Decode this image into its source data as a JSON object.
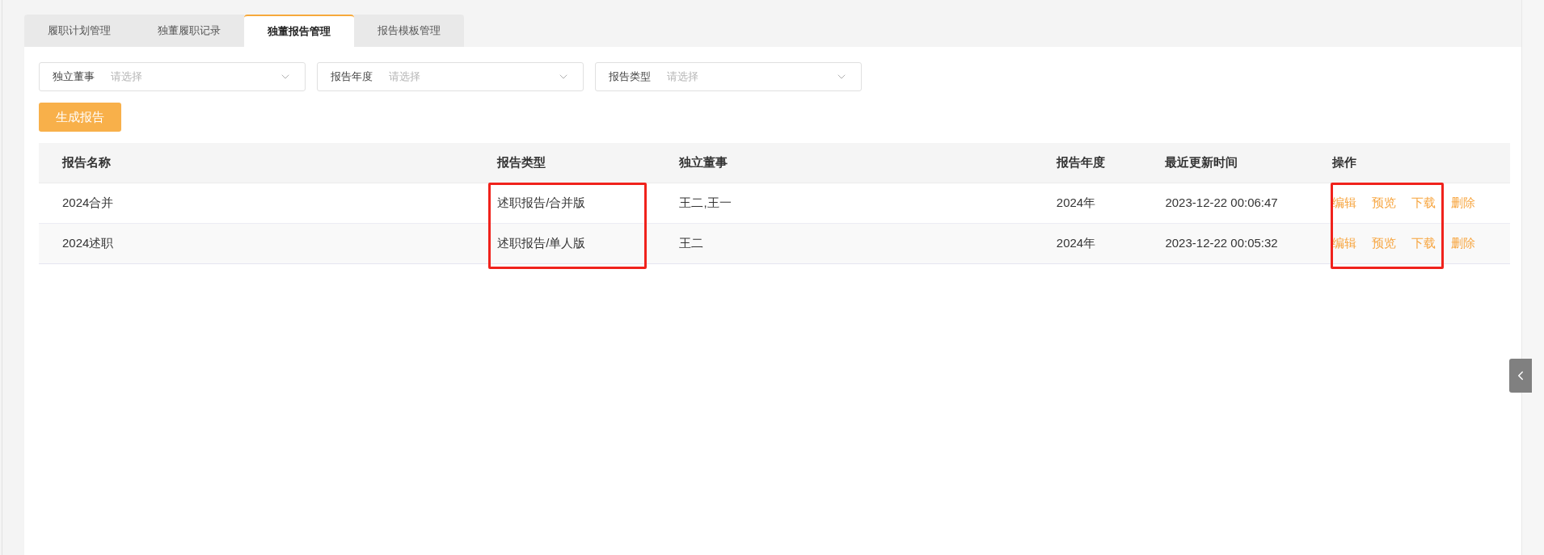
{
  "tabs": [
    {
      "label": "履职计划管理",
      "selected": false
    },
    {
      "label": "独董履职记录",
      "selected": false
    },
    {
      "label": "独董报告管理",
      "selected": true
    },
    {
      "label": "报告模板管理",
      "selected": false
    }
  ],
  "filters": [
    {
      "label": "独立董事",
      "placeholder": "请选择"
    },
    {
      "label": "报告年度",
      "placeholder": "请选择"
    },
    {
      "label": "报告类型",
      "placeholder": "请选择"
    }
  ],
  "generate_button": "生成报告",
  "table": {
    "columns": [
      {
        "label": "报告名称",
        "highlighted": false
      },
      {
        "label": "报告类型",
        "highlighted": true
      },
      {
        "label": "独立董事",
        "highlighted": false
      },
      {
        "label": "报告年度",
        "highlighted": false
      },
      {
        "label": "最近更新时间",
        "highlighted": false
      },
      {
        "label": "操作",
        "highlighted": true
      }
    ],
    "rows": [
      {
        "cells": [
          "2024合并",
          "述职报告/合并版",
          "王二,王一",
          "2024年",
          "2023-12-22 00:06:47"
        ],
        "actions": [
          "编辑",
          "预览",
          "下载",
          "删除"
        ]
      },
      {
        "cells": [
          "2024述职",
          "述职报告/单人版",
          "王二",
          "2024年",
          "2023-12-22 00:05:32"
        ],
        "actions": [
          "编辑",
          "预览",
          "下载",
          "删除"
        ]
      }
    ]
  }
}
